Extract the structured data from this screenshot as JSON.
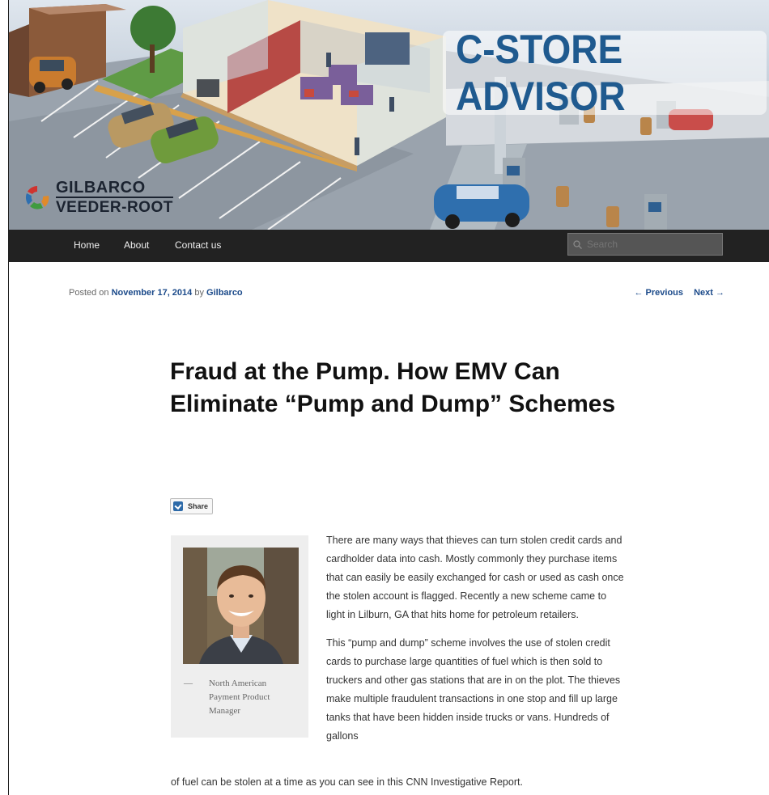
{
  "header": {
    "site_title": "C-STORE ADVISOR",
    "logo_line1": "GILBARCO",
    "logo_line2": "VEEDER-ROOT"
  },
  "nav": {
    "items": [
      {
        "label": "Home"
      },
      {
        "label": "About"
      },
      {
        "label": "Contact us"
      }
    ],
    "search_placeholder": "Search"
  },
  "post": {
    "posted_on_label": "Posted on",
    "date": "November 17, 2014",
    "by_label": "by",
    "author": "Gilbarco",
    "prev_label": "← Previous",
    "next_label": "Next →",
    "title": "Fraud at the Pump. How EMV Can Eliminate “Pump and Dump” Schemes",
    "share_label": "Share",
    "caption_dash": "—",
    "caption": "North American Payment Product Manager",
    "paragraph1": "There are many ways that thieves can turn stolen credit cards and cardholder data into cash.  Mostly commonly they purchase items that can easily be easily exchanged for cash or used as cash once the stolen account is flagged.  Recently a new scheme came to light in Lilburn, GA that hits home for petroleum retailers.",
    "paragraph2": "This “pump and dump” scheme involves the use of stolen credit cards to purchase large quantities of fuel which is then sold to truckers and other gas stations that are in on the plot.  The thieves make multiple fraudulent transactions in one stop and fill up large tanks that have been hidden inside trucks or vans.  Hundreds of gallons",
    "paragraph2_tail": "of fuel can be stolen at a time as you can see in this CNN Investigative Report."
  },
  "colors": {
    "nav_bg": "#222222",
    "link": "#1b4a8a",
    "title_blue": "#1f5a8f"
  }
}
